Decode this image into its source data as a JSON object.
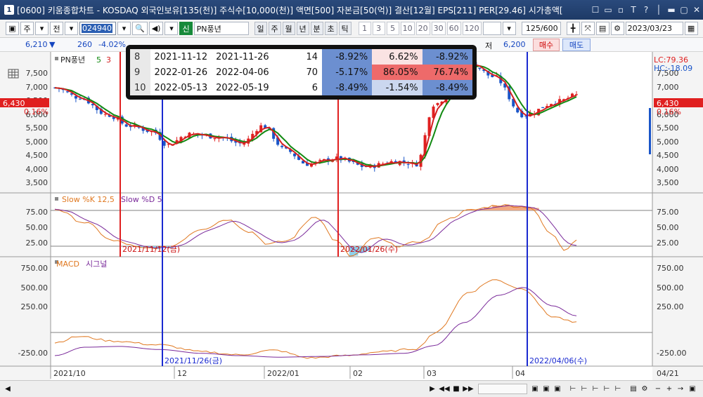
{
  "window": {
    "num": "1",
    "title": "[0600] 키움종합차트 - KOSDAQ 외국인보유[135(천)] 주식수[10,000(천)] 액면[500] 자본금[50(억)] 결산[12월] EPS[211] PER[29.46] 시가총액[",
    "controls": [
      "☐",
      "▭",
      "▫",
      "T",
      "?",
      "│",
      "▬",
      "▢",
      "✕"
    ]
  },
  "toolbar": {
    "type_label": "주",
    "market_label": "전",
    "code": "024940",
    "badge": "신",
    "stock_name": "PN풍년",
    "periods": [
      {
        "label": "일",
        "active": true
      },
      {
        "label": "주",
        "active": false
      },
      {
        "label": "월",
        "active": false
      },
      {
        "label": "년",
        "active": false
      },
      {
        "label": "분",
        "active": false
      },
      {
        "label": "초",
        "active": false
      },
      {
        "label": "틱",
        "active": false
      }
    ],
    "intervals": [
      "1",
      "3",
      "5",
      "10",
      "20",
      "30",
      "60",
      "120"
    ],
    "count": "125",
    "count_total": "/600",
    "date": "2023/03/23"
  },
  "quote": {
    "price": "6,210",
    "change_arrow": "▼",
    "change": "260",
    "change_pct": "-4.02%",
    "tail": "52",
    "buy_label": "매수",
    "sell_label": "매도",
    "low_label": "저",
    "low_value": "6,200"
  },
  "popup": {
    "rows": [
      {
        "idx": "8",
        "start": "2021-11-12",
        "end": "2021-11-26",
        "n": "14",
        "p1": "-8.92%",
        "p2": "6.62%",
        "p3": "-8.92%"
      },
      {
        "idx": "9",
        "start": "2022-01-26",
        "end": "2022-04-06",
        "n": "70",
        "p1": "-5.17%",
        "p2": "86.05%",
        "p3": "76.74%"
      },
      {
        "idx": "10",
        "start": "2022-05-13",
        "end": "2022-05-19",
        "n": "6",
        "p1": "-8.49%",
        "p2": "-1.54%",
        "p3": "-8.49%"
      }
    ],
    "colors": {
      "neg_strong": "#6c8fd0",
      "neg_light": "#cbd7ef",
      "pos_strong": "#ee6a6a",
      "pos_light": "#fae3e3"
    }
  },
  "price_pane": {
    "legend_name": "PN풍년",
    "legend_p1": "5",
    "legend_p2": "3",
    "current_price": "6,430",
    "current_pct": "0.16%",
    "lc_label": "LC:79.36",
    "hc_label": "HC:-18.09",
    "y_ticks": [
      "7,500",
      "7,000",
      "6,500",
      "6,000",
      "5,500",
      "5,000",
      "4,500",
      "4,000",
      "3,500"
    ]
  },
  "stoch_pane": {
    "legend_k": "Slow %K 12,5",
    "legend_d": "Slow %D 5",
    "y_ticks": [
      "75.00",
      "50.00",
      "25.00"
    ],
    "mark_label_1": "2021/11/12(금)",
    "mark_label_2": "2022/01/26(수)"
  },
  "macd_pane": {
    "legend_macd": "MACD",
    "legend_signal": "시그널",
    "y_ticks": [
      "750.00",
      "500.00",
      "250.00",
      "-250.00"
    ],
    "mark_label_1": "2021/11/26(금)",
    "mark_label_2": "2022/04/06(수)"
  },
  "x_axis": {
    "labels": [
      "2021/10",
      "12",
      "2022/01",
      "02",
      "03",
      "04",
      "04/21"
    ]
  },
  "colors": {
    "up_candle": "#e02020",
    "down_candle": "#1a55c8",
    "ma_short": "#d42020",
    "ma_long": "#128a12",
    "stoch_k": "#e07820",
    "stoch_d": "#7a2a9a",
    "macd": "#e07820",
    "signal": "#7a2a9a",
    "marker_red": "#e02020",
    "marker_blue": "#1a2ad0"
  }
}
